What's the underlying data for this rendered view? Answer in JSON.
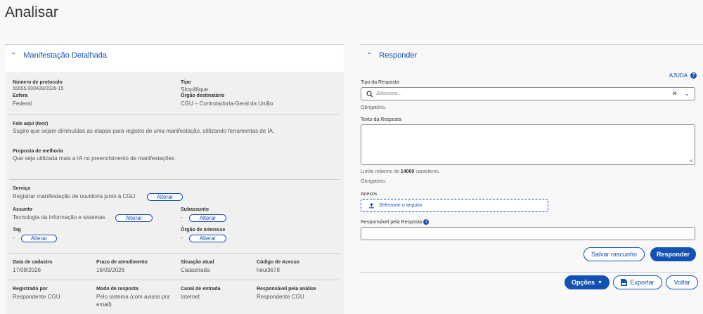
{
  "page": {
    "title": "Analisar"
  },
  "left": {
    "section_title": "Manifestação Detalhada",
    "protocolo": {
      "label": "Número de protocolo",
      "value": "55555.000428/2026-15"
    },
    "tipo": {
      "label": "Tipo",
      "value": "Simplifique"
    },
    "esfera": {
      "label": "Esfera",
      "value": "Federal"
    },
    "orgao_destinatario": {
      "label": "Órgão destinatário",
      "value": "CGU – Controladoria-Geral da União"
    },
    "fale_aqui": {
      "label": "Fale aqui (teor)",
      "value": "Sugiro que sejam diminuídas as etapas para registro de uma manifestação, utilizando ferramentas de IA."
    },
    "proposta": {
      "label": "Proposta de melhoria",
      "value": "Que seja utilizada mais a IA no preenchimento de manifestações"
    },
    "servico": {
      "label": "Serviço",
      "value": "Registrar manifestação de ouvidoria junto à CGU"
    },
    "assunto": {
      "label": "Assunto",
      "value": "Tecnologia da informação e sistemas"
    },
    "subassunto": {
      "label": "Subassunto",
      "value": "-"
    },
    "tag": {
      "label": "Tag",
      "value": "-"
    },
    "orgao_interesse": {
      "label": "Órgão de interesse",
      "value": "-"
    },
    "alterar_label": "Alterar",
    "data_cadastro": {
      "label": "Data de cadastro",
      "value": "17/08/2026"
    },
    "prazo": {
      "label": "Prazo de atendimento",
      "value": "16/09/2026"
    },
    "situacao": {
      "label": "Situação atual",
      "value": "Cadastrada"
    },
    "codigo": {
      "label": "Código de Acesso",
      "value": "heui3678"
    },
    "registrado_por": {
      "label": "Registrado por",
      "value": "Respondente CGU"
    },
    "modo_resposta": {
      "label": "Modo de resposta",
      "value": "Pelo sistema (com avisos por email)"
    },
    "canal": {
      "label": "Canal de entrada",
      "value": "Internet"
    },
    "responsavel_analise": {
      "label": "Responsável pela análise",
      "value": "Respondente CGU"
    }
  },
  "right": {
    "section_title": "Responder",
    "ajuda_label": "AJUDA",
    "tipo_resposta": {
      "label": "Tipo da Resposta",
      "placeholder": "Selecione...",
      "hint": "Obrigatório."
    },
    "texto_resposta": {
      "label": "Texto da Resposta",
      "limit_prefix": "Limite máximo de ",
      "limit_number": "14000",
      "limit_suffix": " caracteres.",
      "hint": "Obrigatório."
    },
    "anexos": {
      "label": "Anexos",
      "placeholder": "Selecione o arquivo"
    },
    "responsavel": {
      "label": "Responsável pela Resposta"
    },
    "buttons": {
      "salvar": "Salvar rascunho",
      "responder": "Responder",
      "opcoes": "Opções",
      "exportar": "Exportar",
      "voltar": "Voltar"
    }
  },
  "colors": {
    "primary": "#1351b4",
    "panel_bg": "#f0f0f0",
    "page_bg": "#f8f8f8"
  }
}
